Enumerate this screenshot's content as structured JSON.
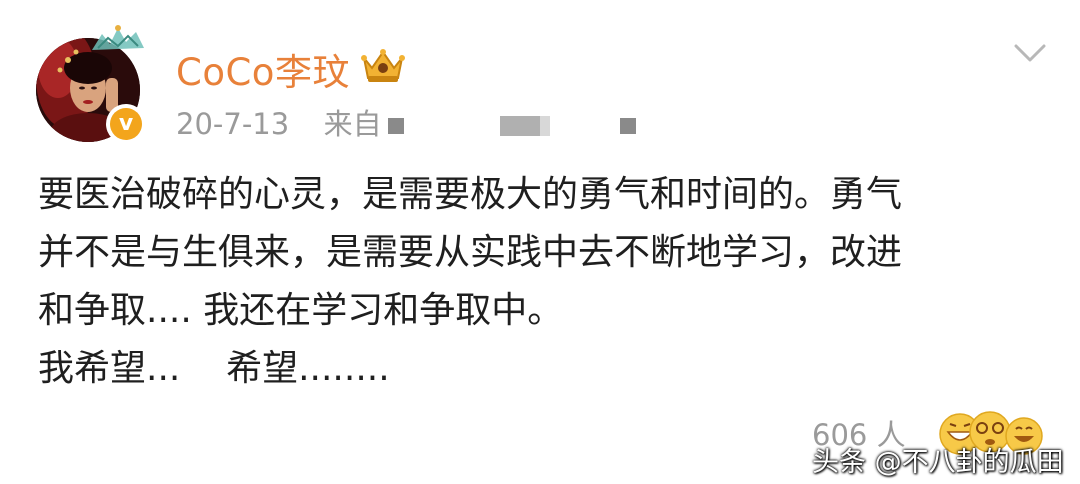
{
  "post": {
    "author": {
      "name": "CoCo李玟",
      "verified_symbol": "v",
      "vip_badge_icon": "vip-crown-icon",
      "avatar_icon": "avatar-photo"
    },
    "meta": {
      "date": "20-7-13",
      "source_prefix": "来自"
    },
    "body_lines": [
      "要医治破碎的心灵，是需要极大的勇气和时间的。勇气",
      "并不是与生俱来，是需要从实践中去不断地学习，改进",
      "和争取.... 我还在学习和争取中。",
      "我希望...    希望........"
    ],
    "likes": "606 人",
    "reaction_icons": [
      "grin-emoji-icon",
      "dizzy-emoji-icon",
      "laugh-emoji-icon"
    ]
  },
  "watermark": "头条 @不八卦的瓜田",
  "colors": {
    "username": "#e8813a",
    "meta": "#9a9a9a",
    "verified": "#f3a51c",
    "body_text": "#1f1f1f"
  }
}
